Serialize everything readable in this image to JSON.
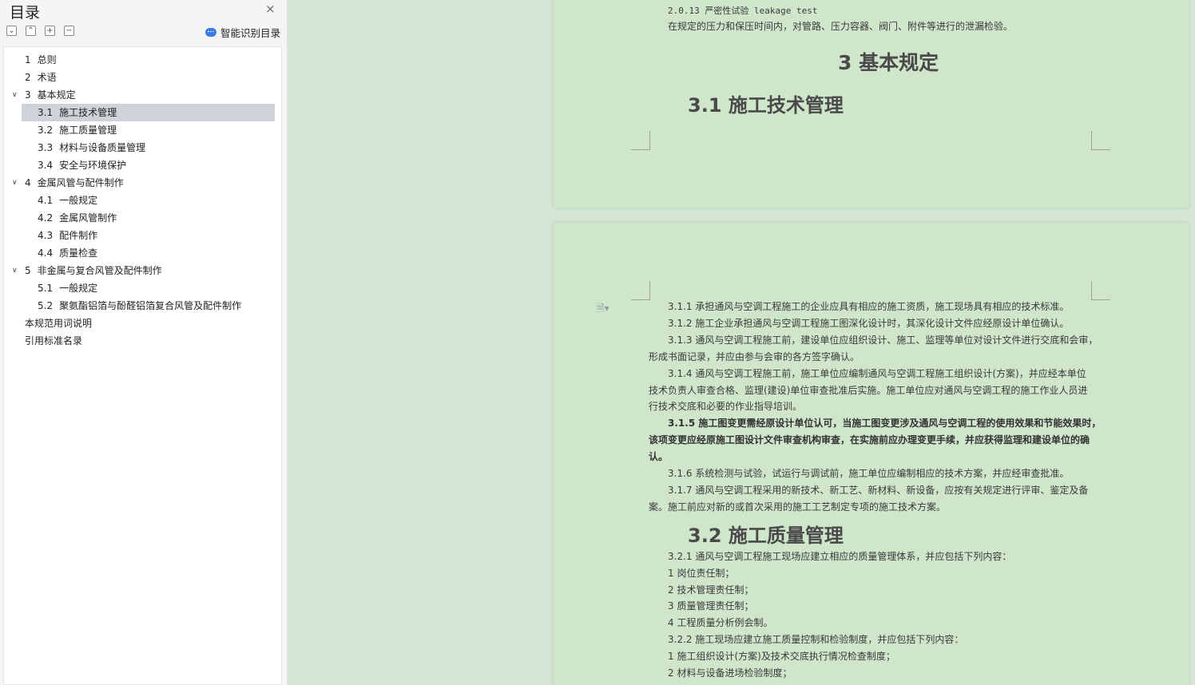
{
  "sidebar": {
    "title": "目录",
    "close_icon": "×",
    "toolbar_icons": [
      "⌄",
      "⌃",
      "+",
      "−"
    ],
    "smart_button_label": "智能识别目录",
    "items": [
      {
        "num": "1",
        "label": "总则",
        "level": 1
      },
      {
        "num": "2",
        "label": "术语",
        "level": 1
      },
      {
        "num": "3",
        "label": "基本规定",
        "level": 1,
        "expanded": true
      },
      {
        "num": "3.1",
        "label": "施工技术管理",
        "level": 2,
        "selected": true
      },
      {
        "num": "3.2",
        "label": "施工质量管理",
        "level": 2
      },
      {
        "num": "3.3",
        "label": "材料与设备质量管理",
        "level": 2
      },
      {
        "num": "3.4",
        "label": "安全与环境保护",
        "level": 2
      },
      {
        "num": "4",
        "label": "金属风管与配件制作",
        "level": 1,
        "expanded": true
      },
      {
        "num": "4.1",
        "label": "一般规定",
        "level": 2
      },
      {
        "num": "4.2",
        "label": "金属风管制作",
        "level": 2
      },
      {
        "num": "4.3",
        "label": "配件制作",
        "level": 2
      },
      {
        "num": "4.4",
        "label": "质量检查",
        "level": 2
      },
      {
        "num": "5",
        "label": "非金属与复合风管及配件制作",
        "level": 1,
        "expanded": true
      },
      {
        "num": "5.1",
        "label": "一般规定",
        "level": 2
      },
      {
        "num": "5.2",
        "label": "聚氨酯铝箔与酚醛铝箔复合风管及配件制作",
        "level": 2
      },
      {
        "num": "",
        "label": "本规范用词说明",
        "level": 1
      },
      {
        "num": "",
        "label": "引用标准名录",
        "level": 1
      }
    ]
  },
  "document": {
    "page1": {
      "term_line": "2.0.13 严密性试验 leakage test",
      "term_def": "在规定的压力和保压时间内，对管路、压力容器、阀门、附件等进行的泄漏检验。",
      "chapter_heading": "3  基本规定",
      "section_heading": "3.1  施工技术管理"
    },
    "page2": {
      "lines": [
        "3.1.1 承担通风与空调工程施工的企业应具有相应的施工资质，施工现场具有相应的技术标准。",
        "3.1.2 施工企业承担通风与空调工程施工图深化设计时，其深化设计文件应经原设计单位确认。",
        "3.1.3 通风与空调工程施工前，建设单位应组织设计、施工、监理等单位对设计文件进行交底和会审，",
        "形成书面记录，并应由参与会审的各方签字确认。",
        "3.1.4 通风与空调工程施工前，施工单位应编制通风与空调工程施工组织设计(方案)，并应经本单位",
        "技术负责人审查合格、监理(建设)单位审查批准后实施。施工单位应对通风与空调工程的施工作业人员进",
        "行技术交底和必要的作业指导培训。",
        "3.1.5 施工图变更需经原设计单位认可，当施工图变更涉及通风与空调工程的使用效果和节能效果时，",
        "该项变更应经原施工图设计文件审查机构审查，在实施前应办理变更手续，并应获得监理和建设单位的确",
        "认。",
        "3.1.6 系统检测与试验，试运行与调试前，施工单位应编制相应的技术方案，并应经审查批准。",
        "3.1.7 通风与空调工程采用的新技术、新工艺、新材料、新设备，应按有关规定进行评审、鉴定及备",
        "案。施工前应对新的或首次采用的施工工艺制定专项的施工技术方案。"
      ],
      "section2_heading": "3.2  施工质量管理",
      "lines2": [
        "3.2.1 通风与空调工程施工现场应建立相应的质量管理体系，并应包括下列内容：",
        "1   岗位责任制；",
        "2   技术管理责任制；",
        "3   质量管理责任制；",
        "4   工程质量分析例会制。",
        "3.2.2 施工现场应建立施工质量控制和检验制度，并应包括下列内容：",
        "1   施工组织设计(方案)及技术交底执行情况检查制度；",
        "2   材料与设备进场检验制度；"
      ]
    }
  },
  "colors": {
    "page_background": "#cfe6cb",
    "workspace_background": "#d3e7d4",
    "toc_selected": "#cfd3d9",
    "smart_icon": "#3d7be6"
  }
}
